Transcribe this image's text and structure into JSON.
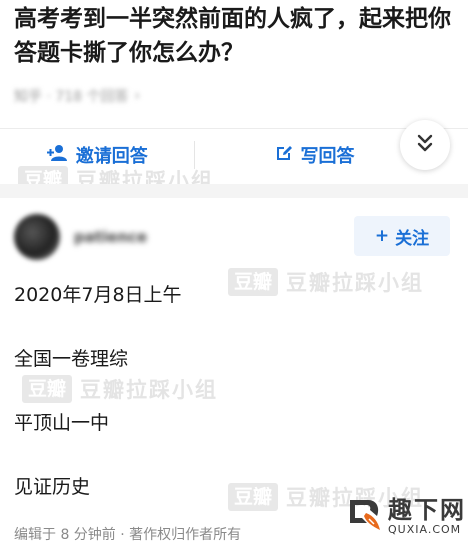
{
  "question": {
    "title": "高考考到一半突然前面的人疯了，起来把你答题卡撕了你怎么办？",
    "meta_text": "知乎 · 718 个回答",
    "meta_chevron": "›"
  },
  "actions": {
    "invite_label": "邀请回答",
    "write_label": "写回答",
    "expand_icon": "double-chevron-down-icon",
    "accent_color": "#1a6fd6"
  },
  "answer": {
    "author_name": "patience",
    "follow_label": "关注",
    "follow_plus": "+",
    "date": "2020年7月8日上午",
    "lines": [
      "全国一卷理综",
      "平顶山一中",
      "见证历史"
    ],
    "footer": "编辑于 8 分钟前 · 著作权归作者所有"
  },
  "watermark": {
    "box_text": "豆瓣",
    "text": "豆瓣拉踩小组"
  },
  "corner_logo": {
    "cn": "趣下网",
    "en": "QUXIA.COM"
  }
}
